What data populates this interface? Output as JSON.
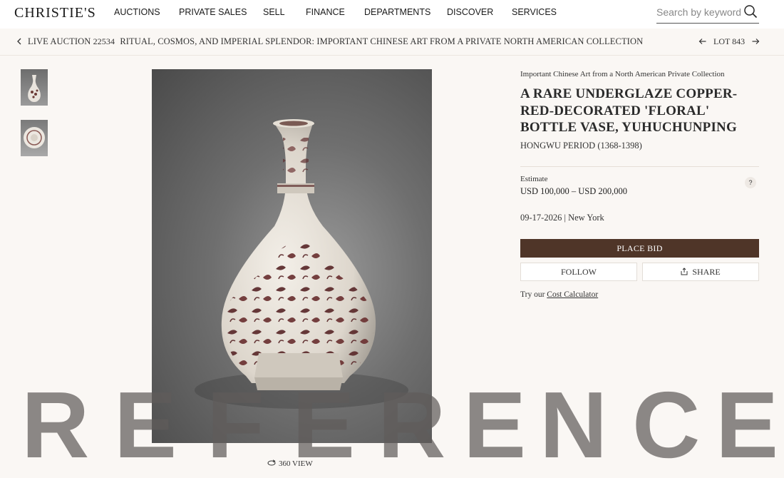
{
  "site": {
    "logo": "CHRISTIE'S"
  },
  "nav": {
    "items": [
      "AUCTIONS",
      "PRIVATE SALES",
      "SELL",
      "FINANCE",
      "DEPARTMENTS",
      "DISCOVER",
      "SERVICES"
    ],
    "search_placeholder": "Search by keyword"
  },
  "breadcrumb": {
    "sale_type": "LIVE AUCTION",
    "sale_number": "22534",
    "sale_title": "RITUAL, COSMOS, AND IMPERIAL SPLENDOR: IMPORTANT CHINESE ART FROM A PRIVATE NORTH AMERICAN COLLECTION",
    "lot_label": "LOT 843"
  },
  "gallery": {
    "thumbnails": [
      "vase-side-view",
      "vase-top-view"
    ],
    "view360_label": "360 VIEW"
  },
  "lot": {
    "collection": "Important Chinese Art from a North American Private Collection",
    "title": "A RARE UNDERGLAZE COPPER-RED-DECORATED 'FLORAL' BOTTLE VASE, YUHUCHUNPING",
    "period": "HONGWU PERIOD (1368-1398)",
    "estimate_label": "Estimate",
    "estimate_value": "USD 100,000 – USD 200,000",
    "help_label": "?",
    "sale_date": "09-17-2026",
    "sale_location": "New York",
    "bid_label": "PLACE BID",
    "follow_label": "FOLLOW",
    "share_label": "SHARE",
    "calc_prefix": "Try our",
    "calc_link": "Cost Calculator"
  },
  "watermark": {
    "letters": [
      "R",
      "E",
      "F",
      "E",
      "R",
      "E",
      "N",
      "C",
      "E"
    ]
  },
  "colors": {
    "bid_button": "#4f3528",
    "page_background": "#faf7f4",
    "nav_background": "#ffffff"
  }
}
